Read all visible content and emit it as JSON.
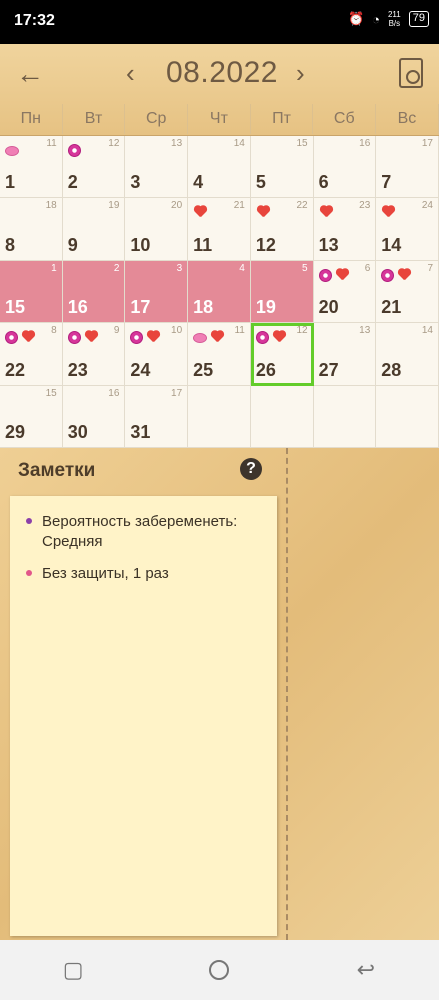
{
  "status_bar": {
    "time": "17:32",
    "speed_top": "211",
    "speed_bottom": "B/s",
    "battery": "79"
  },
  "header": {
    "month": "08.2022",
    "back_icon": "arrow-left-icon",
    "prev_icon": "chevron-left-icon",
    "next_icon": "chevron-right-icon",
    "report_icon": "report-icon"
  },
  "weekdays": [
    "Пн",
    "Вт",
    "Ср",
    "Чт",
    "Пт",
    "Сб",
    "Вс"
  ],
  "calendar": {
    "days": [
      {
        "day": "1",
        "cycle": "11",
        "marks": [
          "drop"
        ]
      },
      {
        "day": "2",
        "cycle": "12",
        "marks": [
          "flower"
        ]
      },
      {
        "day": "3",
        "cycle": "13",
        "marks": []
      },
      {
        "day": "4",
        "cycle": "14",
        "marks": []
      },
      {
        "day": "5",
        "cycle": "15",
        "marks": []
      },
      {
        "day": "6",
        "cycle": "16",
        "marks": []
      },
      {
        "day": "7",
        "cycle": "17",
        "marks": []
      },
      {
        "day": "8",
        "cycle": "18",
        "marks": []
      },
      {
        "day": "9",
        "cycle": "19",
        "marks": []
      },
      {
        "day": "10",
        "cycle": "20",
        "marks": []
      },
      {
        "day": "11",
        "cycle": "21",
        "marks": [
          "heart"
        ]
      },
      {
        "day": "12",
        "cycle": "22",
        "marks": [
          "heart"
        ]
      },
      {
        "day": "13",
        "cycle": "23",
        "marks": [
          "heart"
        ]
      },
      {
        "day": "14",
        "cycle": "24",
        "marks": [
          "heart"
        ]
      },
      {
        "day": "15",
        "cycle": "1",
        "marks": [],
        "period": true
      },
      {
        "day": "16",
        "cycle": "2",
        "marks": [],
        "period": true
      },
      {
        "day": "17",
        "cycle": "3",
        "marks": [],
        "period": true
      },
      {
        "day": "18",
        "cycle": "4",
        "marks": [],
        "period": true
      },
      {
        "day": "19",
        "cycle": "5",
        "marks": [],
        "period": true
      },
      {
        "day": "20",
        "cycle": "6",
        "marks": [
          "flower",
          "heart"
        ]
      },
      {
        "day": "21",
        "cycle": "7",
        "marks": [
          "flower",
          "heart"
        ]
      },
      {
        "day": "22",
        "cycle": "8",
        "marks": [
          "flower",
          "heart"
        ]
      },
      {
        "day": "23",
        "cycle": "9",
        "marks": [
          "flower",
          "heart"
        ]
      },
      {
        "day": "24",
        "cycle": "10",
        "marks": [
          "flower",
          "heart"
        ]
      },
      {
        "day": "25",
        "cycle": "11",
        "marks": [
          "drop",
          "heart"
        ]
      },
      {
        "day": "26",
        "cycle": "12",
        "marks": [
          "flower",
          "heart"
        ],
        "selected": true
      },
      {
        "day": "27",
        "cycle": "13",
        "marks": []
      },
      {
        "day": "28",
        "cycle": "14",
        "marks": []
      },
      {
        "day": "29",
        "cycle": "15",
        "marks": []
      },
      {
        "day": "30",
        "cycle": "16",
        "marks": []
      },
      {
        "day": "31",
        "cycle": "17",
        "marks": []
      },
      {
        "day": "",
        "cycle": "",
        "marks": []
      },
      {
        "day": "",
        "cycle": "",
        "marks": []
      },
      {
        "day": "",
        "cycle": "",
        "marks": []
      },
      {
        "day": "",
        "cycle": "",
        "marks": []
      }
    ]
  },
  "notes": {
    "title": "Заметки",
    "help": "?",
    "items": [
      {
        "text": "Вероятность забеременеть: Средняя",
        "color": "#8b3fa9"
      },
      {
        "text": "Без защиты, 1 раз",
        "color": "#e2568a"
      }
    ]
  },
  "navbar": {
    "back_icon": "nav-back-icon",
    "home_icon": "home-icon",
    "recent_icon": "recent-apps-icon"
  }
}
